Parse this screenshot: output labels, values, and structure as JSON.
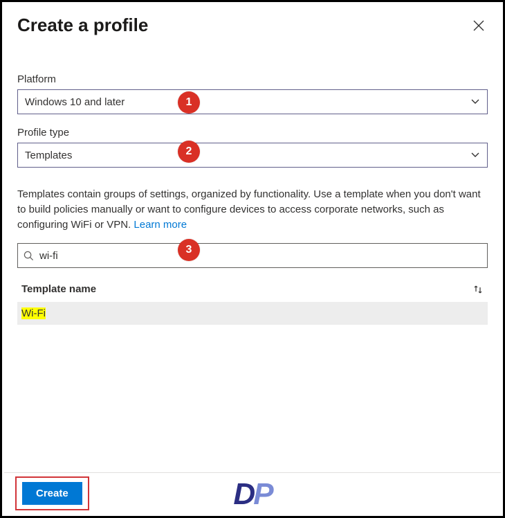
{
  "header": {
    "title": "Create a profile"
  },
  "platform": {
    "label": "Platform",
    "value": "Windows 10 and later"
  },
  "profileType": {
    "label": "Profile type",
    "value": "Templates"
  },
  "description": {
    "text": "Templates contain groups of settings, organized by functionality. Use a template when you don't want to build policies manually or want to configure devices to access corporate networks, such as configuring WiFi or VPN. ",
    "learnMore": "Learn more"
  },
  "search": {
    "value": "wi-fi"
  },
  "table": {
    "columnHeader": "Template name",
    "rows": [
      {
        "name": "Wi-Fi"
      }
    ]
  },
  "footer": {
    "createLabel": "Create"
  },
  "annotations": {
    "badge1": "1",
    "badge2": "2",
    "badge3": "3"
  }
}
